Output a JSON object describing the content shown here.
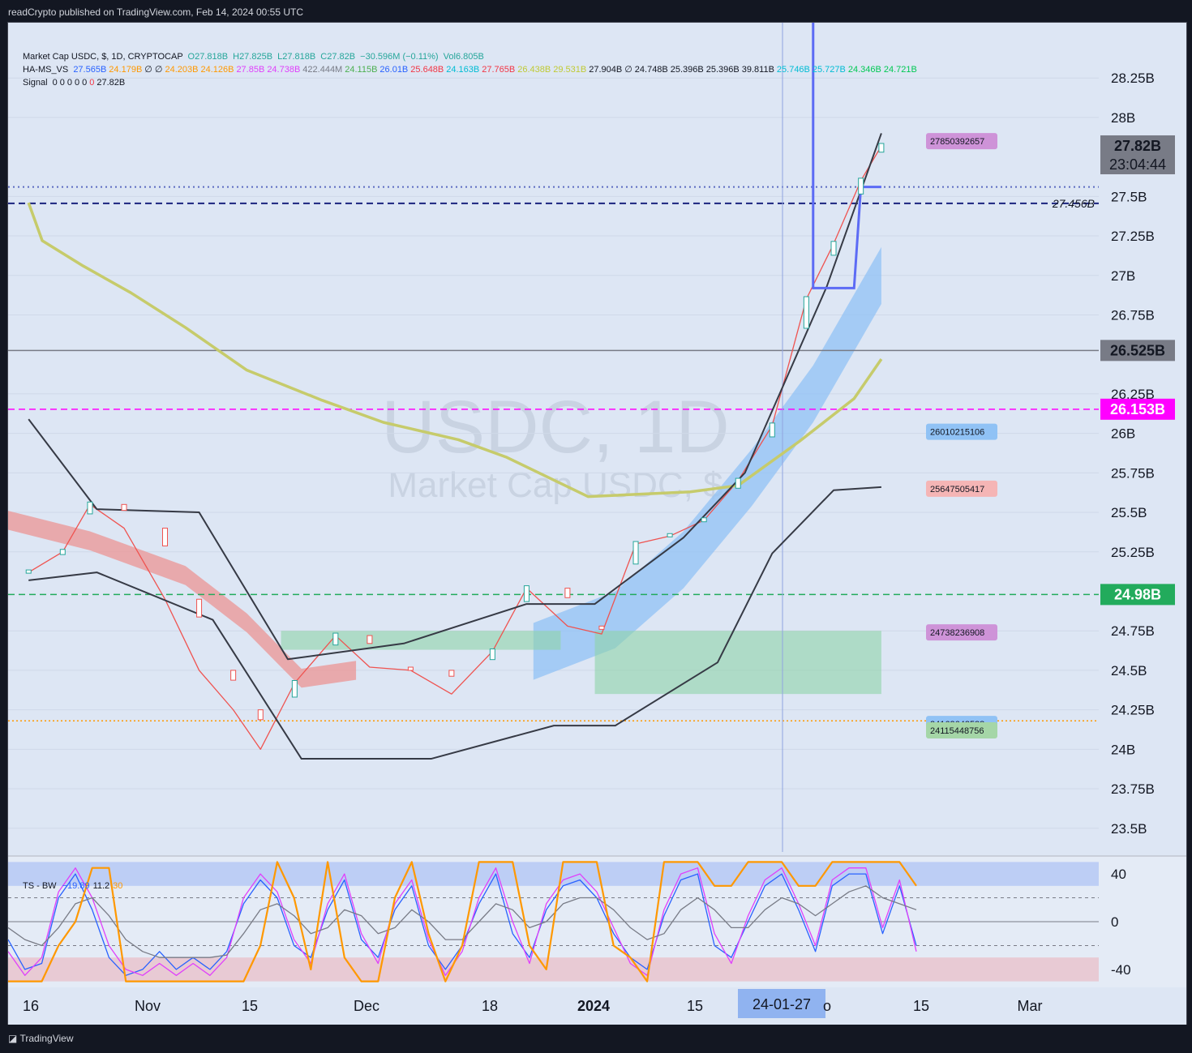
{
  "header": {
    "publisher": "readCrypto published on TradingView.com, Feb 14, 2024 00:55 UTC"
  },
  "footer": {
    "logo": "TradingView"
  },
  "legend": {
    "main_title": "Market Cap USDC, $, 1D, CRYPTOCAP",
    "ohlc": {
      "o": "O27.818B",
      "h": "H27.825B",
      "l": "L27.818B",
      "c": "C27.82B",
      "chg": "−30.596M (−0.11%)",
      "vol": "Vol6.805B"
    },
    "ha_label": "HA-MS_VS",
    "ha_values": [
      {
        "t": "27.565B",
        "c": "#2962ff"
      },
      {
        "t": "24.179B",
        "c": "#ff9800"
      },
      {
        "t": "∅",
        "c": "#131722"
      },
      {
        "t": "∅",
        "c": "#131722"
      },
      {
        "t": "24.203B",
        "c": "#ff9800"
      },
      {
        "t": "24.126B",
        "c": "#ff9800"
      },
      {
        "t": "27.85B",
        "c": "#e040fb"
      },
      {
        "t": "24.738B",
        "c": "#e040fb"
      },
      {
        "t": "422.444M",
        "c": "#787b86"
      },
      {
        "t": "24.115B",
        "c": "#4caf50"
      },
      {
        "t": "26.01B",
        "c": "#2962ff"
      },
      {
        "t": "25.648B",
        "c": "#f23645"
      },
      {
        "t": "24.163B",
        "c": "#00bcd4"
      },
      {
        "t": "27.765B",
        "c": "#f23645"
      },
      {
        "t": "26.438B",
        "c": "#c0ca33"
      },
      {
        "t": "29.531B",
        "c": "#c0ca33"
      },
      {
        "t": "27.904B",
        "c": "#131722"
      },
      {
        "t": "∅",
        "c": "#131722"
      },
      {
        "t": "24.748B",
        "c": "#131722"
      },
      {
        "t": "25.396B",
        "c": "#131722"
      },
      {
        "t": "25.396B",
        "c": "#131722"
      },
      {
        "t": "39.811B",
        "c": "#131722"
      },
      {
        "t": "25.746B",
        "c": "#00bcd4"
      },
      {
        "t": "25.727B",
        "c": "#00bcd4"
      },
      {
        "t": "24.346B",
        "c": "#00c853"
      },
      {
        "t": "24.721B",
        "c": "#00c853"
      }
    ],
    "signal_label": "Signal",
    "signal_values": [
      {
        "t": "0",
        "c": "#131722"
      },
      {
        "t": "0",
        "c": "#131722"
      },
      {
        "t": "0",
        "c": "#131722"
      },
      {
        "t": "0",
        "c": "#131722"
      },
      {
        "t": "0",
        "c": "#131722"
      },
      {
        "t": "0",
        "c": "#f23645"
      },
      {
        "t": "27.82B",
        "c": "#131722"
      }
    ]
  },
  "osc_legend": {
    "name": "TS - BW",
    "values": [
      {
        "t": "−19.89",
        "c": "#2962ff"
      },
      {
        "t": "11.2",
        "c": "#131722"
      },
      {
        "t": "30",
        "c": "#ff9800"
      }
    ]
  },
  "watermark": {
    "line1": "USDC, 1D",
    "line2": "Market Cap USDC, $"
  },
  "colors": {
    "background": "#dde6f4",
    "price_up": "#26a69a",
    "price_down": "#ef5350",
    "ichimoku": "#c6cb6b",
    "band_blue": "#90c2f5",
    "band_red": "#eb9a9a",
    "last_price": "#787b86",
    "magenta": "#ff00ff",
    "green_level": "#22ab5c"
  },
  "chart_data": {
    "type": "line",
    "title": "USDC, 1D",
    "subtitle": "Market Cap USDC, $",
    "y_unit": "B",
    "ylim": [
      23.35,
      28.6
    ],
    "y_ticks": [
      "28.25B",
      "28B",
      "27.5B",
      "27.25B",
      "27B",
      "26.75B",
      "26.25B",
      "26B",
      "25.75B",
      "25.5B",
      "25.25B",
      "24.75B",
      "24.5B",
      "24.25B",
      "24B",
      "23.75B",
      "23.5B"
    ],
    "x_ticks": [
      "16",
      "Nov",
      "15",
      "Dec",
      "18",
      "2024",
      "15",
      "24-01-27",
      "o",
      "15",
      "Mar"
    ],
    "series": [
      {
        "name": "Market Cap USDC",
        "color": "#26a69a",
        "x": [
          "2023-10-11",
          "2023-10-16",
          "2023-10-20",
          "2023-10-25",
          "2023-10-31",
          "2023-11-05",
          "2023-11-10",
          "2023-11-14",
          "2023-11-19",
          "2023-11-25",
          "2023-11-30",
          "2023-12-06",
          "2023-12-12",
          "2023-12-18",
          "2023-12-23",
          "2023-12-29",
          "2024-01-03",
          "2024-01-08",
          "2024-01-13",
          "2024-01-18",
          "2024-01-23",
          "2024-01-28",
          "2024-02-02",
          "2024-02-06",
          "2024-02-10",
          "2024-02-13"
        ],
        "values": [
          25.12,
          25.25,
          25.55,
          25.4,
          24.95,
          24.5,
          24.25,
          24.0,
          24.42,
          24.72,
          24.52,
          24.5,
          24.35,
          24.62,
          25.02,
          24.78,
          24.73,
          25.3,
          25.35,
          25.45,
          25.7,
          26.05,
          26.85,
          27.2,
          27.6,
          27.82
        ]
      },
      {
        "name": "Ichimoku base",
        "color": "#c6cb6b",
        "x": [
          "2023-10-11",
          "2023-10-13",
          "2023-10-19",
          "2023-10-26",
          "2023-11-03",
          "2023-11-12",
          "2023-11-23",
          "2023-12-02",
          "2023-12-13",
          "2023-12-20",
          "2024-01-01",
          "2024-01-16",
          "2024-01-23",
          "2024-02-01",
          "2024-02-09",
          "2024-02-13"
        ],
        "values": [
          27.46,
          27.22,
          27.06,
          26.89,
          26.67,
          26.4,
          26.21,
          26.07,
          25.96,
          25.85,
          25.6,
          25.63,
          25.67,
          25.95,
          26.22,
          26.47
        ]
      },
      {
        "name": "Donchian upper",
        "color": "#363a45",
        "x": [
          "2023-10-11",
          "2023-10-21",
          "2023-11-05",
          "2023-11-18",
          "2023-12-05",
          "2023-12-23",
          "2024-01-02",
          "2024-01-15",
          "2024-01-24",
          "2024-02-05",
          "2024-02-13"
        ],
        "values": [
          26.09,
          25.52,
          25.5,
          24.57,
          24.67,
          24.92,
          24.92,
          25.34,
          25.75,
          26.93,
          27.9
        ]
      },
      {
        "name": "Donchian lower",
        "color": "#363a45",
        "x": [
          "2023-10-11",
          "2023-10-21",
          "2023-11-07",
          "2023-11-20",
          "2023-12-09",
          "2023-12-27",
          "2024-01-05",
          "2024-01-20",
          "2024-01-28",
          "2024-02-06",
          "2024-02-13"
        ],
        "values": [
          25.07,
          25.12,
          24.82,
          23.94,
          23.94,
          24.15,
          24.15,
          24.55,
          25.24,
          25.64,
          25.66
        ]
      }
    ],
    "horizontal_levels": [
      {
        "label": "27.456B",
        "value": 27.456,
        "style": "dashed",
        "color": "#1a237e"
      },
      {
        "label": "26.525B",
        "value": 26.525,
        "style": "solid",
        "color": "#787b86"
      },
      {
        "label": "26.153B",
        "value": 26.153,
        "style": "dashed",
        "color": "#ff00ff"
      },
      {
        "label": "24.98B",
        "value": 24.98,
        "style": "dashed",
        "color": "#22ab5c"
      }
    ],
    "price_tags": [
      {
        "value": "27.82B",
        "time": "23:04:44",
        "color": "#787b86"
      },
      {
        "value": "26.525B",
        "color": "#787b86"
      },
      {
        "value": "26.153B",
        "color": "#ff00ff"
      },
      {
        "value": "24.98B",
        "color": "#22ab5c"
      }
    ],
    "line_labels": [
      {
        "label": "27850392657",
        "value": 27.85,
        "color": "#ce93d8"
      },
      {
        "label": "26010215106",
        "value": 26.01,
        "color": "#90c2f5"
      },
      {
        "label": "25647505417",
        "value": 25.65,
        "color": "#f5b5b5"
      },
      {
        "label": "24738236908",
        "value": 24.74,
        "color": "#ce93d8"
      },
      {
        "label": "24162643588",
        "value": 24.16,
        "color": "#90c2f5"
      },
      {
        "label": "24115448756",
        "value": 24.12,
        "color": "#a5d6a7"
      }
    ],
    "oscillator": {
      "name": "TS - BW",
      "ylim": [
        -55,
        55
      ],
      "y_ticks": [
        40,
        0,
        -40
      ],
      "series": [
        {
          "name": "fast",
          "color": "#2962ff",
          "values": [
            -15,
            -40,
            -35,
            20,
            40,
            10,
            -30,
            -45,
            -40,
            -25,
            -40,
            -30,
            -40,
            -25,
            15,
            35,
            20,
            -20,
            -30,
            10,
            35,
            -15,
            -30,
            10,
            30,
            -20,
            -40,
            -20,
            15,
            40,
            -10,
            -30,
            10,
            30,
            35,
            20,
            -10,
            -30,
            -40,
            5,
            35,
            40,
            -20,
            -30,
            0,
            30,
            40,
            10,
            -25,
            30,
            40,
            40,
            -10,
            30,
            -20
          ]
        },
        {
          "name": "signal",
          "color": "#e040fb",
          "values": [
            -25,
            -45,
            -30,
            25,
            45,
            20,
            -20,
            -40,
            -45,
            -35,
            -45,
            -35,
            -45,
            -30,
            20,
            40,
            25,
            -15,
            -35,
            15,
            40,
            -10,
            -35,
            15,
            35,
            -15,
            -45,
            -25,
            20,
            45,
            0,
            -35,
            15,
            35,
            40,
            25,
            -5,
            -35,
            -45,
            10,
            40,
            45,
            -10,
            -35,
            5,
            35,
            45,
            15,
            -20,
            35,
            45,
            45,
            -5,
            35,
            -25
          ]
        },
        {
          "name": "slow",
          "color": "#787b86",
          "values": [
            -5,
            -15,
            -20,
            -5,
            15,
            20,
            5,
            -15,
            -25,
            -30,
            -30,
            -30,
            -30,
            -28,
            -10,
            10,
            15,
            5,
            -10,
            -5,
            10,
            5,
            -10,
            -5,
            10,
            0,
            -15,
            -15,
            0,
            15,
            10,
            -5,
            0,
            15,
            20,
            20,
            10,
            -5,
            -15,
            -10,
            10,
            20,
            10,
            -5,
            -5,
            10,
            20,
            15,
            5,
            15,
            25,
            30,
            20,
            15,
            10
          ]
        },
        {
          "name": "histogram",
          "color": "#ff9800",
          "values": [
            -50,
            -50,
            -50,
            -20,
            0,
            45,
            45,
            -50,
            -50,
            -50,
            -50,
            -50,
            -50,
            -50,
            -50,
            -20,
            50,
            20,
            -40,
            50,
            -30,
            -50,
            -50,
            20,
            50,
            -10,
            -50,
            -20,
            50,
            50,
            50,
            -20,
            -40,
            50,
            50,
            50,
            -20,
            -30,
            -50,
            50,
            50,
            50,
            30,
            30,
            50,
            50,
            50,
            30,
            30,
            50,
            50,
            50,
            50,
            50,
            30
          ]
        }
      ]
    }
  }
}
